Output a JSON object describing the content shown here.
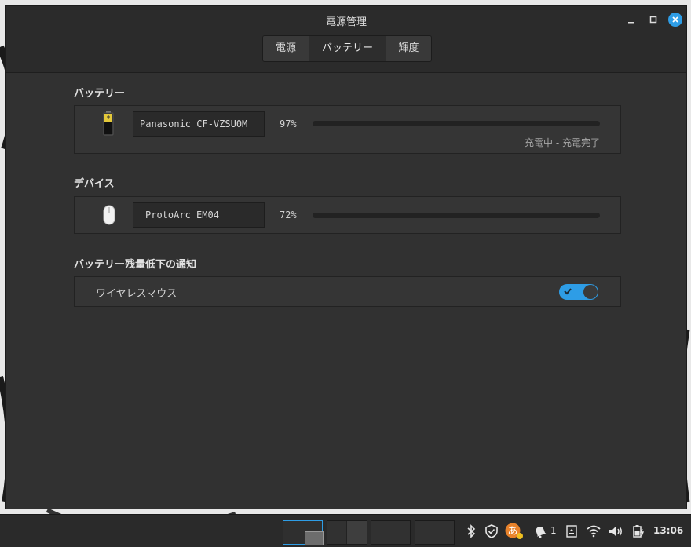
{
  "window": {
    "title": "電源管理",
    "tabs": [
      {
        "label": "電源"
      },
      {
        "label": "バッテリー"
      },
      {
        "label": "輝度"
      }
    ],
    "active_tab": "バッテリー"
  },
  "battery_section": {
    "title": "バッテリー",
    "items": [
      {
        "icon": "battery-icon",
        "name": "Panasonic CF-VZSU0M",
        "percent": "97%",
        "level": 0.97,
        "status": "充電中 - 充電完了"
      }
    ]
  },
  "devices_section": {
    "title": "デバイス",
    "items": [
      {
        "icon": "mouse-icon",
        "name": "ProtoArc EM04",
        "percent": "72%",
        "level": 0.72
      }
    ]
  },
  "low_battery_section": {
    "title": "バッテリー残量低下の通知",
    "items": [
      {
        "label": "ワイヤレスマウス",
        "enabled": true
      }
    ]
  },
  "taskbar": {
    "notification_count": "1",
    "clock": "13:06"
  },
  "colors": {
    "accent": "#2e9de6",
    "window_bg": "#313131",
    "panel_bg": "#2a2a2a"
  }
}
